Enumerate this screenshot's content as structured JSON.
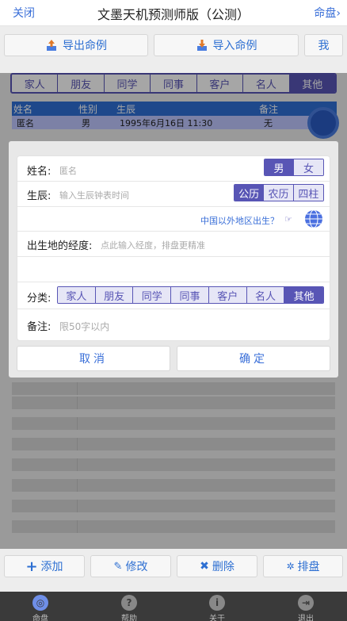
{
  "header": {
    "close": "关闭",
    "title": "文墨天机预测师版（公测）",
    "menu": "命盘",
    "menu_arrow": "›"
  },
  "toolbar": {
    "export": "导出命例",
    "import": "导入命例",
    "me": "我"
  },
  "categories": [
    "家人",
    "朋友",
    "同学",
    "同事",
    "客户",
    "名人",
    "其他"
  ],
  "list": {
    "columns": [
      "姓名",
      "性别",
      "生辰",
      "备注"
    ],
    "rows": [
      {
        "name": "匿名",
        "gender": "男",
        "birth": "1995年6月16日 11:30",
        "note": "无"
      }
    ]
  },
  "form": {
    "name_label": "姓名:",
    "name_placeholder": "匿名",
    "gender": [
      "男",
      "女"
    ],
    "birth_label": "生辰:",
    "birth_placeholder": "输入生辰钟表时间",
    "calendar": [
      "公历",
      "农历",
      "四柱"
    ],
    "abroad_link": "中国以外地区出生？",
    "longitude_label": "出生地的经度:",
    "longitude_placeholder": "点此输入经度，排盘更精准",
    "category_label": "分类:",
    "note_label": "备注:",
    "note_placeholder": "限50字以内"
  },
  "dialog": {
    "cancel": "取消",
    "confirm": "确定"
  },
  "actions": {
    "add": "添加",
    "edit": "修改",
    "delete": "删除",
    "chart": "排盘"
  },
  "tabs": [
    {
      "label": "命盘"
    },
    {
      "label": "帮助"
    },
    {
      "label": "关于"
    },
    {
      "label": "退出"
    }
  ],
  "colors": {
    "accent": "#5855b5",
    "link": "#3a6fd8",
    "header_row": "#2f6fd6"
  }
}
